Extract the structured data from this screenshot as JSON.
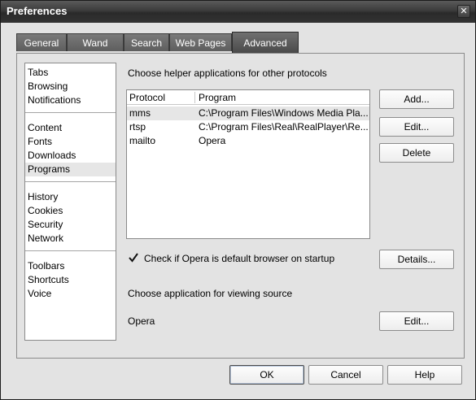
{
  "window": {
    "title": "Preferences"
  },
  "tabs": [
    {
      "label": "General"
    },
    {
      "label": "Wand"
    },
    {
      "label": "Search"
    },
    {
      "label": "Web Pages"
    },
    {
      "label": "Advanced"
    }
  ],
  "sidebar": {
    "groups": [
      [
        "Tabs",
        "Browsing",
        "Notifications"
      ],
      [
        "Content",
        "Fonts",
        "Downloads",
        "Programs"
      ],
      [
        "History",
        "Cookies",
        "Security",
        "Network"
      ],
      [
        "Toolbars",
        "Shortcuts",
        "Voice"
      ]
    ],
    "selected": "Programs"
  },
  "programs": {
    "protocols_heading": "Choose helper applications for other protocols",
    "columns": [
      "Protocol",
      "Program"
    ],
    "rows": [
      {
        "protocol": "mms",
        "program": "C:\\Program Files\\Windows Media Pla..."
      },
      {
        "protocol": "rtsp",
        "program": "C:\\Program Files\\Real\\RealPlayer\\Re..."
      },
      {
        "protocol": "mailto",
        "program": "Opera"
      }
    ],
    "buttons": {
      "add": "Add...",
      "edit": "Edit...",
      "delete": "Delete",
      "details": "Details...",
      "source_edit": "Edit..."
    },
    "default_check_label": "Check if Opera is default browser on startup",
    "default_check_checked": true,
    "source_heading": "Choose application for viewing source",
    "source_app": "Opera"
  },
  "footer": {
    "ok": "OK",
    "cancel": "Cancel",
    "help": "Help"
  }
}
